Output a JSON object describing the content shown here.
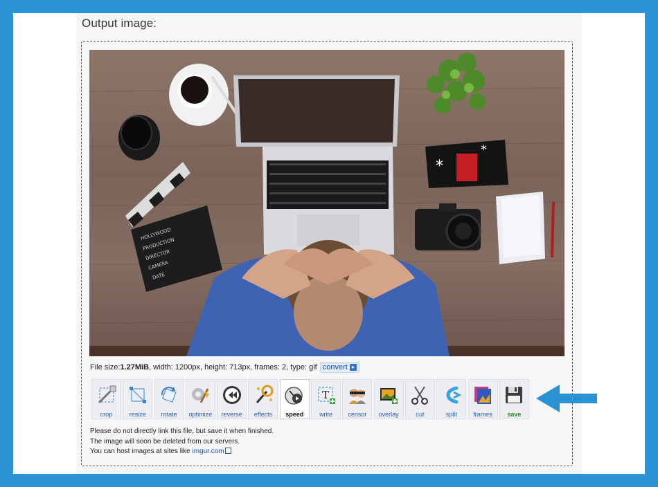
{
  "title": "Output image:",
  "file_info": {
    "size_prefix": "File size: ",
    "size_value": "1.27MiB",
    "rest": ", width: 1200px, height: 713px, frames: 2, type: gif",
    "convert_label": "convert"
  },
  "tools": [
    {
      "label": "crop",
      "icon": "crop-icon"
    },
    {
      "label": "resize",
      "icon": "resize-icon"
    },
    {
      "label": "rotate",
      "icon": "rotate-icon"
    },
    {
      "label": "optimize",
      "icon": "optimize-icon"
    },
    {
      "label": "reverse",
      "icon": "reverse-icon"
    },
    {
      "label": "effects",
      "icon": "effects-icon"
    },
    {
      "label": "speed",
      "icon": "speed-icon"
    },
    {
      "label": "write",
      "icon": "write-icon"
    },
    {
      "label": "censor",
      "icon": "censor-icon"
    },
    {
      "label": "overlay",
      "icon": "overlay-icon"
    },
    {
      "label": "cut",
      "icon": "scissors-icon"
    },
    {
      "label": "split",
      "icon": "split-icon"
    },
    {
      "label": "frames",
      "icon": "frames-icon"
    },
    {
      "label": "save",
      "icon": "floppy-disk-icon"
    }
  ],
  "active_tool": "speed",
  "notes": {
    "line1": "Please do not directly link this file, but save it when finished.",
    "line2": "The image will soon be deleted from our servers.",
    "line3_prefix": "You can host images at sites like ",
    "line3_link": "imgur.com"
  },
  "colors": {
    "background": "#2b93d5",
    "arrow": "#2b93d5",
    "link": "#1c4f9c"
  }
}
